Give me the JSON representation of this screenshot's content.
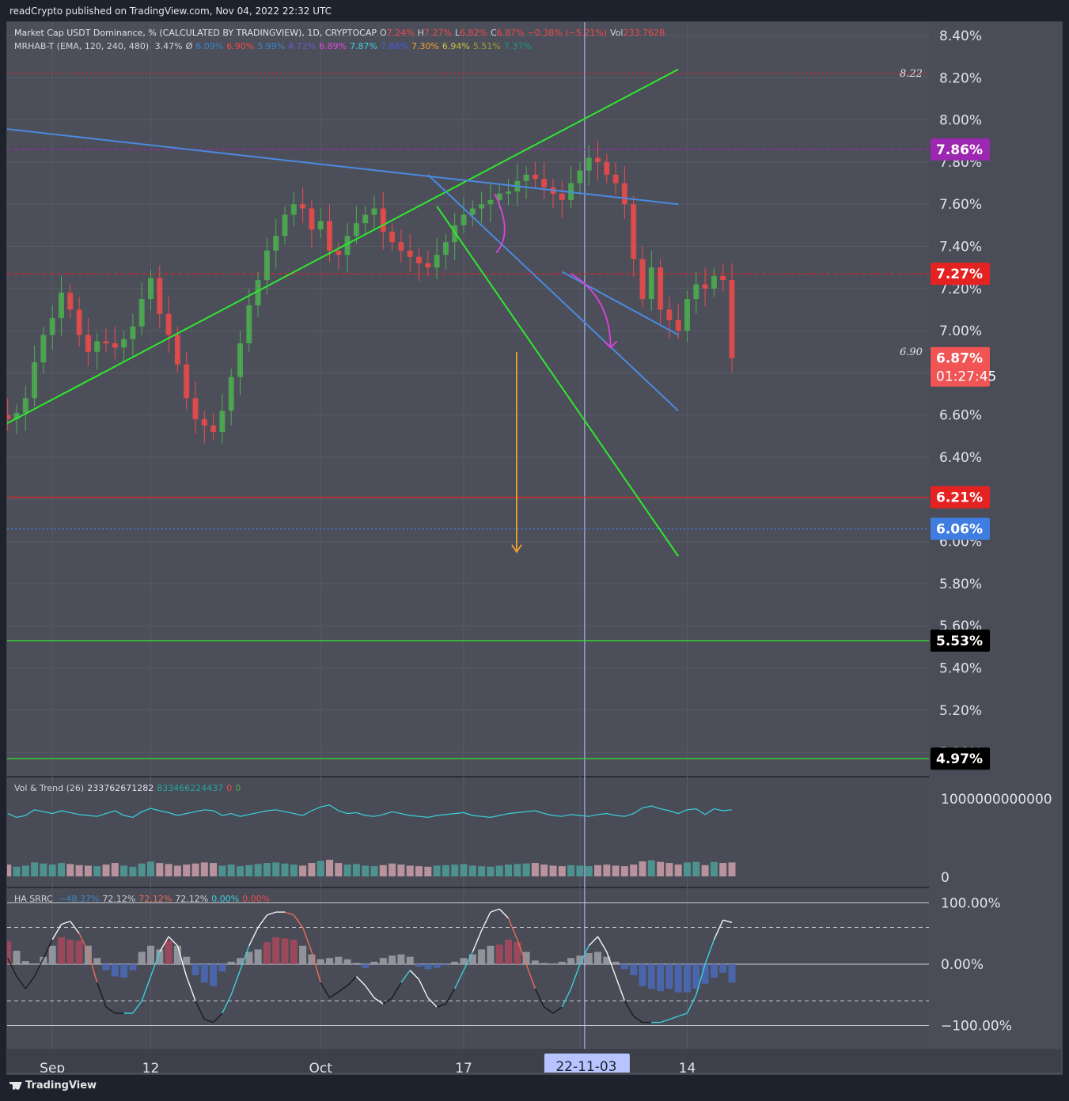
{
  "publisher": "readCrypto published on TradingView.com, Nov 04, 2022 22:32 UTC",
  "brand": "TradingView",
  "symbol_legend": {
    "name": "Market Cap USDT Dominance, % (CALCULATED BY TRADINGVIEW), 1D, CRYPTOCAP",
    "open_label": "O",
    "open": "7.24%",
    "high_label": "H",
    "high": "7.27%",
    "low_label": "L",
    "low": "6.82%",
    "close_label": "C",
    "close": "6.87%",
    "change": "−0.38% (−5.21%)",
    "vol_label": "Vol",
    "vol": "233.762B"
  },
  "indicator_legend": {
    "name": "MRHAB-T (EMA, 120, 240, 480)",
    "values": [
      {
        "text": "3.47%",
        "color": "#d1d4dc"
      },
      {
        "text": "Ø",
        "color": "#d1d4dc"
      },
      {
        "text": "6.09%",
        "color": "#3a86c8"
      },
      {
        "text": "6.90%",
        "color": "#f04a4a"
      },
      {
        "text": "5.99%",
        "color": "#3a86c8"
      },
      {
        "text": "4.72%",
        "color": "#6a5acd"
      },
      {
        "text": "6.89%",
        "color": "#e04ae0"
      },
      {
        "text": "7.87%",
        "color": "#3ad1e0"
      },
      {
        "text": "7.66%",
        "color": "#4a5ae0"
      },
      {
        "text": "7.30%",
        "color": "#f0a030"
      },
      {
        "text": "6.94%",
        "color": "#c8c040"
      },
      {
        "text": "5.51%",
        "color": "#a0a030"
      },
      {
        "text": "7.37%",
        "color": "#1a9a8a"
      }
    ]
  },
  "vol_legend": {
    "name": "Vol & Trend (26)",
    "v1": "233762671282",
    "v1_color": "#f04a4a",
    "v2": "833466224437",
    "v2_color": "#26a69a",
    "v3": "0",
    "v3_color": "#f04a4a",
    "v4": "0",
    "v4_color": "#4caf50"
  },
  "srrc_legend": {
    "name": "HA SRRC",
    "values": [
      {
        "text": "−48.37%",
        "color": "#3a86c8"
      },
      {
        "text": "72.12%",
        "color": "#d1d4dc"
      },
      {
        "text": "72.12%",
        "color": "#f06a5a"
      },
      {
        "text": "72.12%",
        "color": "#d1d4dc"
      },
      {
        "text": "0.00%",
        "color": "#3ad1e0"
      },
      {
        "text": "0.00%",
        "color": "#f04a4a"
      }
    ]
  },
  "colors": {
    "up": "#4caf50",
    "down": "#f04a4a",
    "green_trend": "#2ee82e",
    "blue_trend": "#4a8ae0",
    "orange_arrow": "#f0a030",
    "magenta_arrow": "#e040e0"
  },
  "chart_data": [
    {
      "type": "candlestick",
      "title": "Market Cap USDT Dominance, % (CALCULATED BY TRADINGVIEW), 1D, CRYPTOCAP",
      "ylim": [
        4.9,
        8.5
      ],
      "y_ticks": [
        "8.40%",
        "8.20%",
        "8.00%",
        "7.80%",
        "7.60%",
        "7.40%",
        "7.20%",
        "7.00%",
        "6.80%",
        "6.60%",
        "6.40%",
        "6.20%",
        "6.00%",
        "5.80%",
        "5.60%",
        "5.40%",
        "5.20%",
        "5.00%"
      ],
      "y_tick_values": [
        8.4,
        8.2,
        8.0,
        7.8,
        7.6,
        7.4,
        7.2,
        7.0,
        6.8,
        6.6,
        6.4,
        6.2,
        6.0,
        5.8,
        5.6,
        5.4,
        5.2,
        5.0
      ],
      "x_labels": [
        "Sep",
        "12",
        "Oct",
        "17",
        "22-11-03",
        "14"
      ],
      "x_label_days": [
        4,
        15,
        34,
        50,
        63,
        75
      ],
      "close_series": [
        6.75,
        6.72,
        6.69,
        6.63,
        6.6,
        6.58,
        6.61,
        6.68,
        6.85,
        6.98,
        7.06,
        7.18,
        7.1,
        6.98,
        6.9,
        6.95,
        6.94,
        6.92,
        6.96,
        7.02,
        7.15,
        7.25,
        7.08,
        6.98,
        6.84,
        6.68,
        6.58,
        6.55,
        6.52,
        6.62,
        6.78,
        6.94,
        7.12,
        7.24,
        7.38,
        7.45,
        7.55,
        7.6,
        7.58,
        7.48,
        7.52,
        7.38,
        7.36,
        7.45,
        7.51,
        7.55,
        7.58,
        7.47,
        7.42,
        7.38,
        7.35,
        7.32,
        7.3,
        7.36,
        7.42,
        7.5,
        7.55,
        7.58,
        7.6,
        7.62,
        7.65,
        7.66,
        7.71,
        7.74,
        7.72,
        7.68,
        7.65,
        7.62,
        7.7,
        7.76,
        7.82,
        7.8,
        7.74,
        7.7,
        7.6,
        7.34,
        7.15,
        7.3,
        7.1,
        7.05,
        7.0,
        7.15,
        7.22,
        7.2,
        7.26,
        7.24,
        6.87
      ],
      "price_labels": [
        {
          "text": "7.86%",
          "value": 7.86,
          "bg": "#9c27b0",
          "color": "#ffffff"
        },
        {
          "text": "7.27%",
          "value": 7.27,
          "bg": "#e52222",
          "color": "#ffffff"
        },
        {
          "text": "6.87%",
          "sub": "01:27:45",
          "value": 6.87,
          "bg": "#f05454",
          "color": "#ffffff"
        },
        {
          "text": "6.21%",
          "value": 6.21,
          "bg": "#e52222",
          "color": "#ffffff"
        },
        {
          "text": "6.06%",
          "value": 6.06,
          "bg": "#3f7de0",
          "color": "#ffffff"
        },
        {
          "text": "5.53%",
          "value": 5.53,
          "bg": "#000000",
          "color": "#ffffff"
        },
        {
          "text": "4.97%",
          "value": 4.97,
          "bg": "#000000",
          "color": "#ffffff"
        }
      ],
      "annotations": [
        {
          "text": "8.22",
          "value": 8.22
        },
        {
          "text": "6.90",
          "value": 6.9
        }
      ],
      "horizontal_levels": [
        {
          "value": 8.22,
          "color": "#e52222",
          "style": "dotted"
        },
        {
          "value": 7.86,
          "color": "#9c27b0",
          "style": "dashed"
        },
        {
          "value": 7.27,
          "color": "#e52222",
          "style": "dashed"
        },
        {
          "value": 6.21,
          "color": "#e52222",
          "style": "solid"
        },
        {
          "value": 6.06,
          "color": "#3f7de0",
          "style": "dotted"
        },
        {
          "value": 5.53,
          "color": "#2ee82e",
          "style": "solid"
        },
        {
          "value": 4.97,
          "color": "#2ee82e",
          "style": "solid"
        }
      ],
      "trend_lines": [
        {
          "name": "green-uptrend",
          "from": [
            -6,
            6.45
          ],
          "to": [
            74,
            8.24
          ],
          "color": "#2ee82e"
        },
        {
          "name": "blue-descending",
          "from": [
            -6,
            7.98
          ],
          "to": [
            74,
            7.6
          ],
          "color": "#4a8ae0"
        },
        {
          "name": "green-downtrend",
          "from": [
            47,
            7.59
          ],
          "to": [
            74,
            5.93
          ],
          "color": "#2ee82e"
        },
        {
          "name": "blue-fan-1",
          "from": [
            46,
            7.74
          ],
          "to": [
            74,
            6.62
          ],
          "color": "#4a8ae0"
        },
        {
          "name": "blue-fan-2",
          "from": [
            61,
            7.28
          ],
          "to": [
            74,
            6.98
          ],
          "color": "#4a8ae0"
        }
      ]
    },
    {
      "type": "bar",
      "title": "Vol & Trend (26)",
      "y_ticks": [
        "1000000000000",
        "0"
      ],
      "values": [
        0.45,
        0.4,
        0.42,
        0.5,
        0.38,
        0.44,
        0.36,
        0.4,
        0.52,
        0.48,
        0.44,
        0.5,
        0.46,
        0.42,
        0.4,
        0.38,
        0.44,
        0.5,
        0.4,
        0.36,
        0.48,
        0.55,
        0.5,
        0.46,
        0.4,
        0.44,
        0.48,
        0.52,
        0.5,
        0.4,
        0.44,
        0.38,
        0.42,
        0.46,
        0.5,
        0.52,
        0.48,
        0.44,
        0.4,
        0.5,
        0.58,
        0.62,
        0.5,
        0.44,
        0.46,
        0.4,
        0.38,
        0.42,
        0.48,
        0.44,
        0.4,
        0.38,
        0.36,
        0.4,
        0.42,
        0.44,
        0.46,
        0.4,
        0.38,
        0.36,
        0.4,
        0.44,
        0.46,
        0.48,
        0.5,
        0.44,
        0.4,
        0.38,
        0.42,
        0.4,
        0.38,
        0.42,
        0.44,
        0.4,
        0.38,
        0.44,
        0.56,
        0.6,
        0.54,
        0.5,
        0.44,
        0.52,
        0.54,
        0.42,
        0.54,
        0.5,
        0.52
      ]
    },
    {
      "type": "oscillator",
      "title": "HA SRRC",
      "y_ticks": [
        "100.00%",
        "0.00%",
        "−100.00%"
      ],
      "y_tick_values": [
        100,
        0,
        -100
      ],
      "ylim": [
        -110,
        110
      ],
      "values": [
        85,
        60,
        35,
        10,
        -20,
        -40,
        -20,
        10,
        40,
        65,
        70,
        50,
        20,
        -30,
        -70,
        -80,
        -80,
        -80,
        -60,
        -20,
        20,
        45,
        30,
        -20,
        -60,
        -90,
        -95,
        -80,
        -50,
        -10,
        30,
        60,
        80,
        85,
        85,
        80,
        60,
        20,
        -30,
        -55,
        -45,
        -35,
        -20,
        -35,
        -55,
        -65,
        -55,
        -30,
        -10,
        -25,
        -55,
        -70,
        -65,
        -40,
        -10,
        20,
        55,
        85,
        90,
        75,
        40,
        0,
        -40,
        -70,
        -80,
        -70,
        -40,
        0,
        30,
        45,
        20,
        -20,
        -60,
        -85,
        -95,
        -95,
        -95,
        -90,
        -85,
        -80,
        -50,
        0,
        40,
        72,
        68
      ],
      "hist": [
        55,
        48,
        44,
        38,
        22,
        5,
        0,
        12,
        30,
        44,
        40,
        38,
        30,
        10,
        -10,
        -20,
        -22,
        -10,
        20,
        30,
        24,
        38,
        30,
        12,
        -18,
        -30,
        -36,
        -12,
        4,
        10,
        20,
        24,
        36,
        44,
        42,
        40,
        30,
        16,
        8,
        10,
        12,
        8,
        2,
        -6,
        4,
        10,
        14,
        16,
        12,
        -4,
        -8,
        -6,
        -2,
        4,
        10,
        16,
        24,
        30,
        32,
        40,
        36,
        20,
        6,
        2,
        0,
        4,
        10,
        14,
        18,
        20,
        12,
        4,
        -8,
        -18,
        -36,
        -40,
        -44,
        -40,
        -46,
        -46,
        -40,
        -32,
        -22,
        -14,
        -30
      ]
    }
  ]
}
